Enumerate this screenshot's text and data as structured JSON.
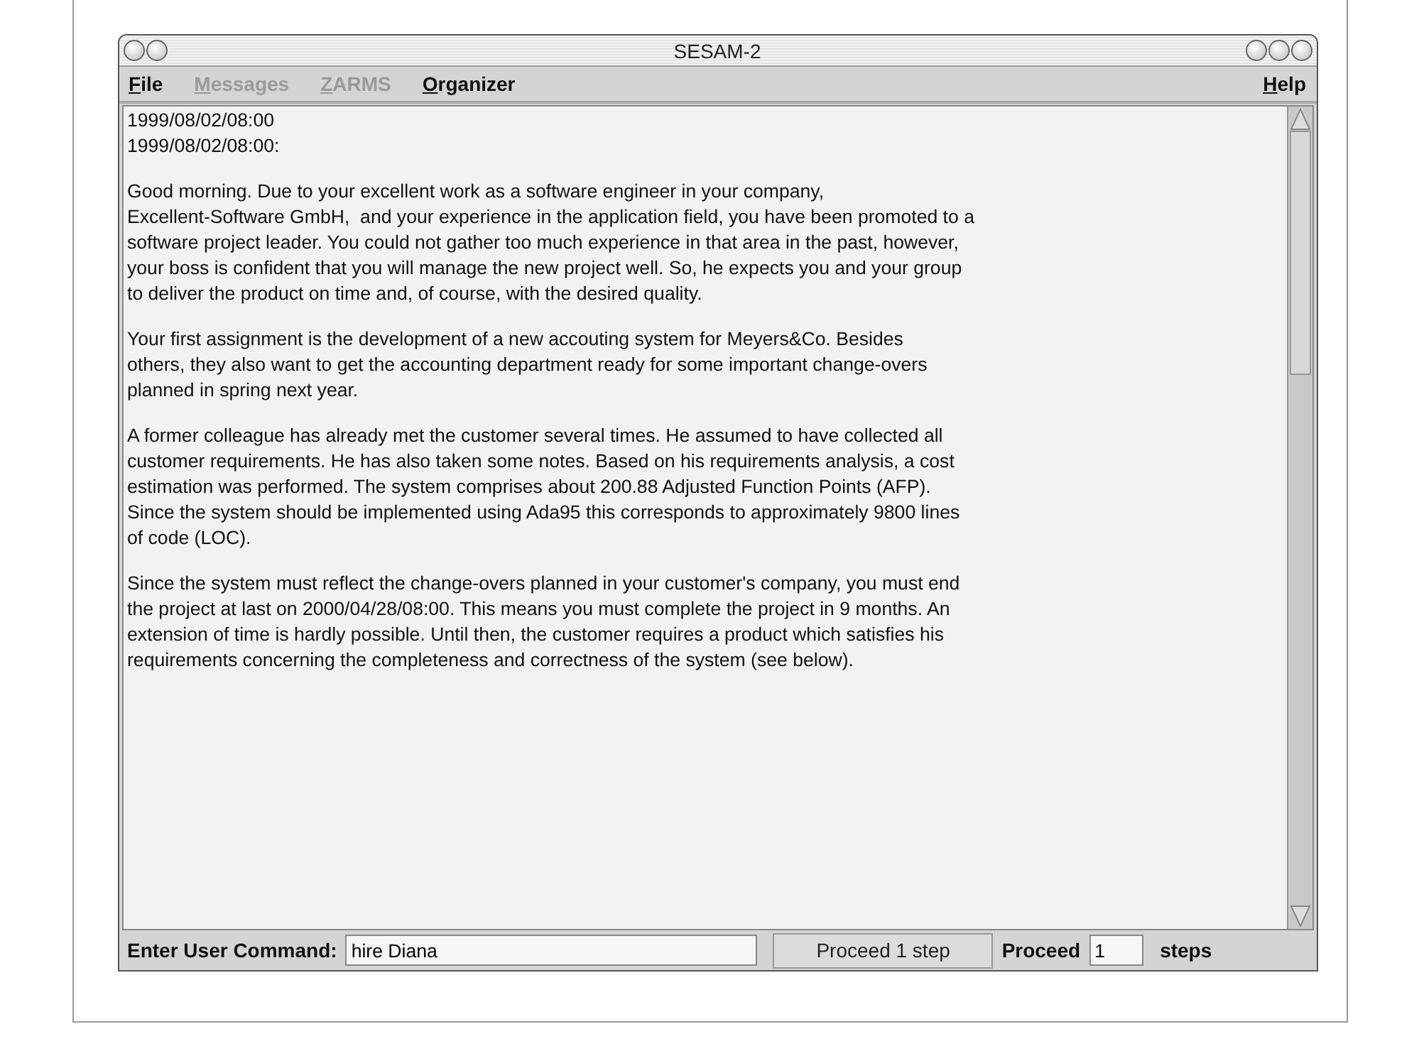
{
  "window": {
    "title": "SESAM-2"
  },
  "menu": [
    {
      "label": "File",
      "disabled": false
    },
    {
      "label": "Messages",
      "disabled": true
    },
    {
      "label": "ZARMS",
      "disabled": true
    },
    {
      "label": "Organizer",
      "disabled": false
    }
  ],
  "help_menu": {
    "label": "Help",
    "disabled": false
  },
  "messages": [
    "1999/08/02/08:00\n1999/08/02/08:00:",
    "Good morning. Due to your excellent work as a software engineer in your company,\nExcellent-Software GmbH,  and your experience in the application field, you have been promoted to a\nsoftware project leader. You could not gather too much experience in that area in the past, however,\nyour boss is confident that you will manage the new project well. So, he expects you and your group\nto deliver the product on time and, of course, with the desired quality.",
    "Your first assignment is the development of a new accouting system for Meyers&Co. Besides\nothers, they also want to get the accounting department ready for some important change-overs\nplanned in spring next year.",
    "A former colleague has already met the customer several times. He assumed to have collected all\ncustomer requirements. He has also taken some notes. Based on his requirements analysis, a cost\nestimation was performed. The system comprises about 200.88 Adjusted Function Points (AFP).\nSince the system should be implemented using Ada95 this corresponds to approximately 9800 lines\nof code (LOC).",
    "Since the system must reflect the change-overs planned in your customer's company, you must end\nthe project at last on 2000/04/28/08:00. This means you must complete the project in 9 months. An\nextension of time is hardly possible. Until then, the customer requires a product which satisfies his\nrequirements concerning the completeness and correctness of the system (see below)."
  ],
  "command_bar": {
    "label": "Enter User Command:",
    "value": "hire Diana",
    "button": "Proceed 1 step",
    "proceed_label": "Proceed",
    "steps_value": "1",
    "steps_label": "steps"
  }
}
